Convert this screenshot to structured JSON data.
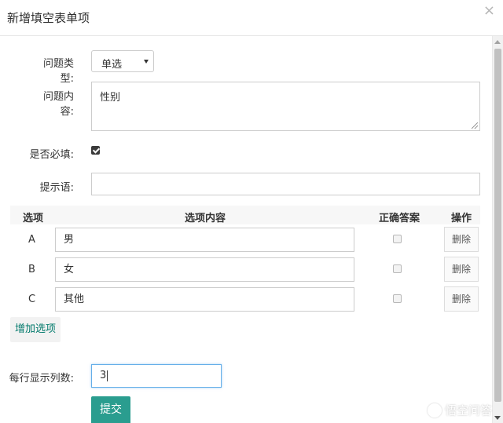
{
  "modal": {
    "title": "新增填空表单项",
    "close_glyph": "×"
  },
  "form": {
    "question_type_label": "问题类型:",
    "question_type_value": "单选",
    "question_content_label": "问题内容:",
    "question_content_value": "性别",
    "required_label": "是否必填:",
    "required_checked": true,
    "hint_label": "提示语:",
    "hint_value": "",
    "columns_label": "每行显示列数:",
    "columns_value": "3"
  },
  "options_table": {
    "headers": {
      "option": "选项",
      "content": "选项内容",
      "correct": "正确答案",
      "action": "操作"
    },
    "rows": [
      {
        "letter": "A",
        "content": "男",
        "correct": false,
        "delete_label": "删除"
      },
      {
        "letter": "B",
        "content": "女",
        "correct": false,
        "delete_label": "删除"
      },
      {
        "letter": "C",
        "content": "其他",
        "correct": false,
        "delete_label": "删除"
      }
    ]
  },
  "buttons": {
    "add_option": "增加选项",
    "submit": "提交"
  },
  "watermark": {
    "text": "悟空问答"
  },
  "colors": {
    "accent": "#2a9d8f",
    "link": "#00796b",
    "focus_border": "#66afe9"
  }
}
